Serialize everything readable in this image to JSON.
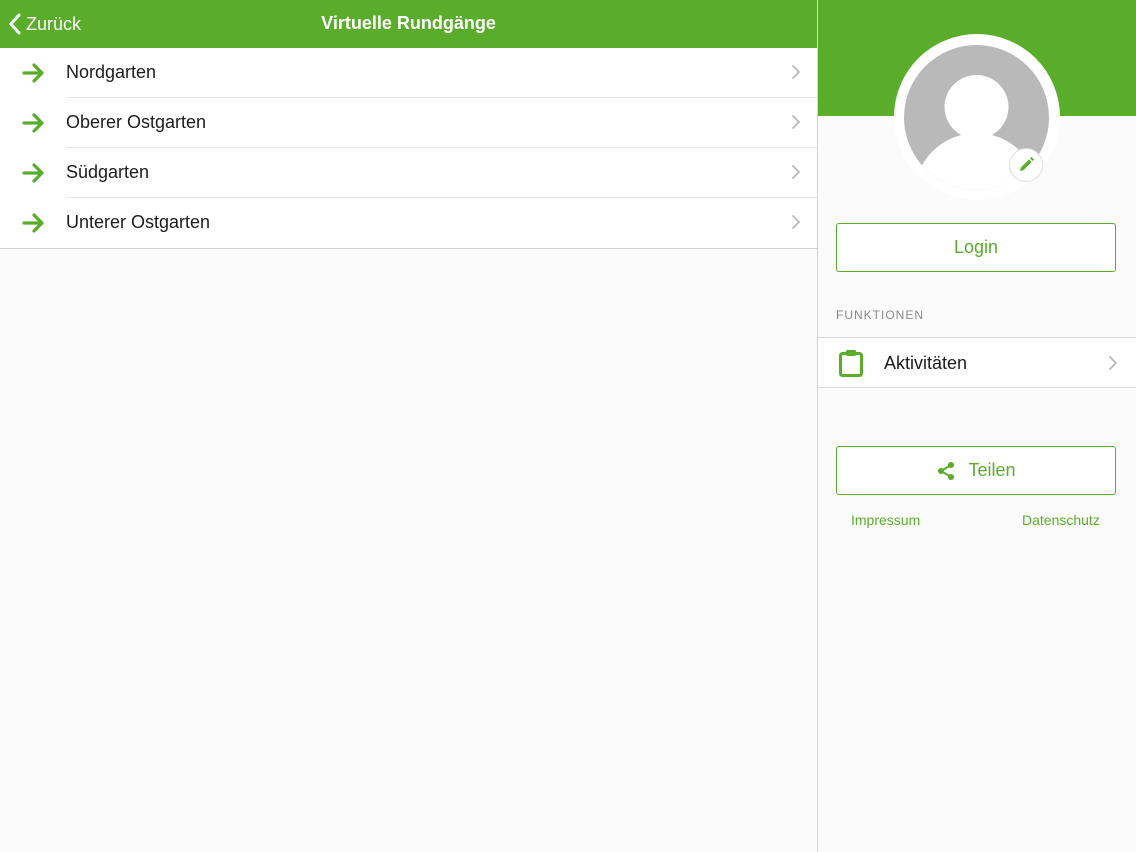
{
  "colors": {
    "accent": "#5aad2b",
    "chevron": "#b8b8b8",
    "avatar": "#b9b9b9"
  },
  "navbar": {
    "back_label": "Zurück",
    "back_icon": "chevron-left-icon",
    "title": "Virtuelle Rundgänge"
  },
  "tours": [
    {
      "label": "Nordgarten",
      "icon": "arrow-right-icon"
    },
    {
      "label": "Oberer Ostgarten",
      "icon": "arrow-right-icon"
    },
    {
      "label": "Südgarten",
      "icon": "arrow-right-icon"
    },
    {
      "label": "Unterer Ostgarten",
      "icon": "arrow-right-icon"
    }
  ],
  "sidebar": {
    "avatar_icon": "user-placeholder-icon",
    "edit_icon": "pencil-icon",
    "login_label": "Login",
    "section_title": "FUNKTIONEN",
    "functions": [
      {
        "label": "Aktivitäten",
        "icon": "clipboard-icon"
      }
    ],
    "share_label": "Teilen",
    "share_icon": "share-icon",
    "imprint_label": "Impressum",
    "privacy_label": "Datenschutz"
  }
}
